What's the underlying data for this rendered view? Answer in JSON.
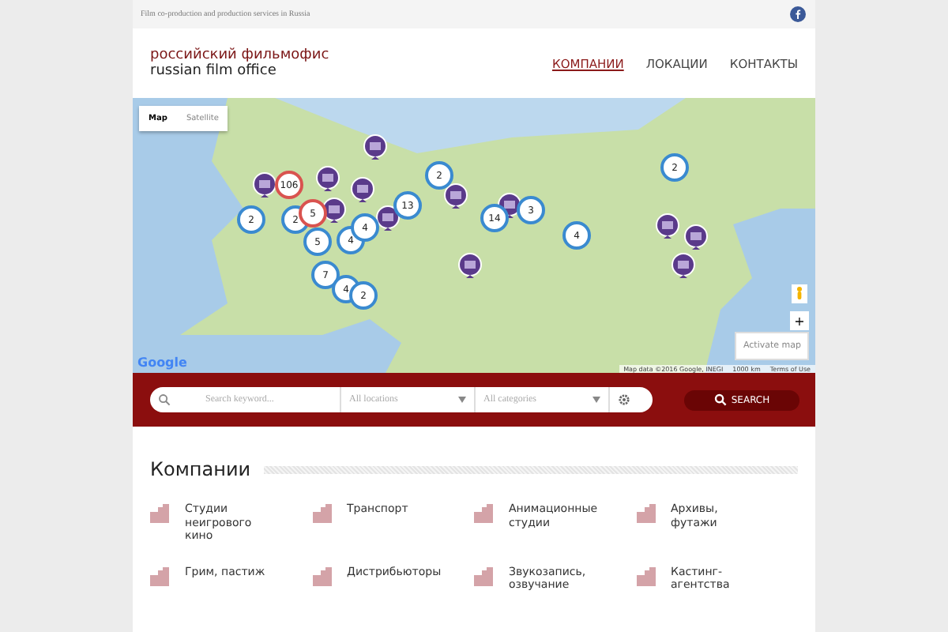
{
  "top_bar": {
    "tagline": "Film co-production and production services in Russia"
  },
  "header": {
    "logo_line_1": "российский фильмофис",
    "logo_line_2": "russian film office",
    "nav": [
      {
        "label": "КОМПАНИИ",
        "selected": true
      },
      {
        "label": "ЛОКАЦИИ",
        "selected": false
      },
      {
        "label": "КОНТАКТЫ",
        "selected": false
      }
    ]
  },
  "map": {
    "type_buttons": [
      {
        "label": "Map",
        "selected": true
      },
      {
        "label": "Satellite",
        "selected": false
      }
    ],
    "clusters": [
      {
        "count": "106",
        "kind": "large"
      },
      {
        "count": "2",
        "kind": "small"
      },
      {
        "count": "2",
        "kind": "small"
      },
      {
        "count": "5",
        "kind": "large"
      },
      {
        "count": "5",
        "kind": "small"
      },
      {
        "count": "4",
        "kind": "small"
      },
      {
        "count": "4",
        "kind": "small"
      },
      {
        "count": "13",
        "kind": "small"
      },
      {
        "count": "2",
        "kind": "small"
      },
      {
        "count": "14",
        "kind": "small"
      },
      {
        "count": "3",
        "kind": "small"
      },
      {
        "count": "4",
        "kind": "small"
      },
      {
        "count": "2",
        "kind": "small"
      },
      {
        "count": "7",
        "kind": "small"
      },
      {
        "count": "4",
        "kind": "small"
      },
      {
        "count": "2",
        "kind": "small"
      }
    ],
    "logo": "Google",
    "attribution": "Map data ©2016 Google, INEGI",
    "scale": "1000 km",
    "terms": "Terms of Use",
    "activate": "Activate map",
    "zoom_in": "+"
  },
  "search": {
    "keyword_placeholder": "Search keyword...",
    "location_placeholder": "All locations",
    "category_placeholder": "All categories",
    "button": "SEARCH"
  },
  "section": {
    "title": "Компании",
    "categories": [
      "Студии неигрового кино",
      "Транспорт",
      "Анимационные студии",
      "Архивы, футажи",
      "Грим, пастиж",
      "Дистрибьюторы",
      "Звукозапись, озвучание",
      "Кастинг-агентства"
    ]
  }
}
